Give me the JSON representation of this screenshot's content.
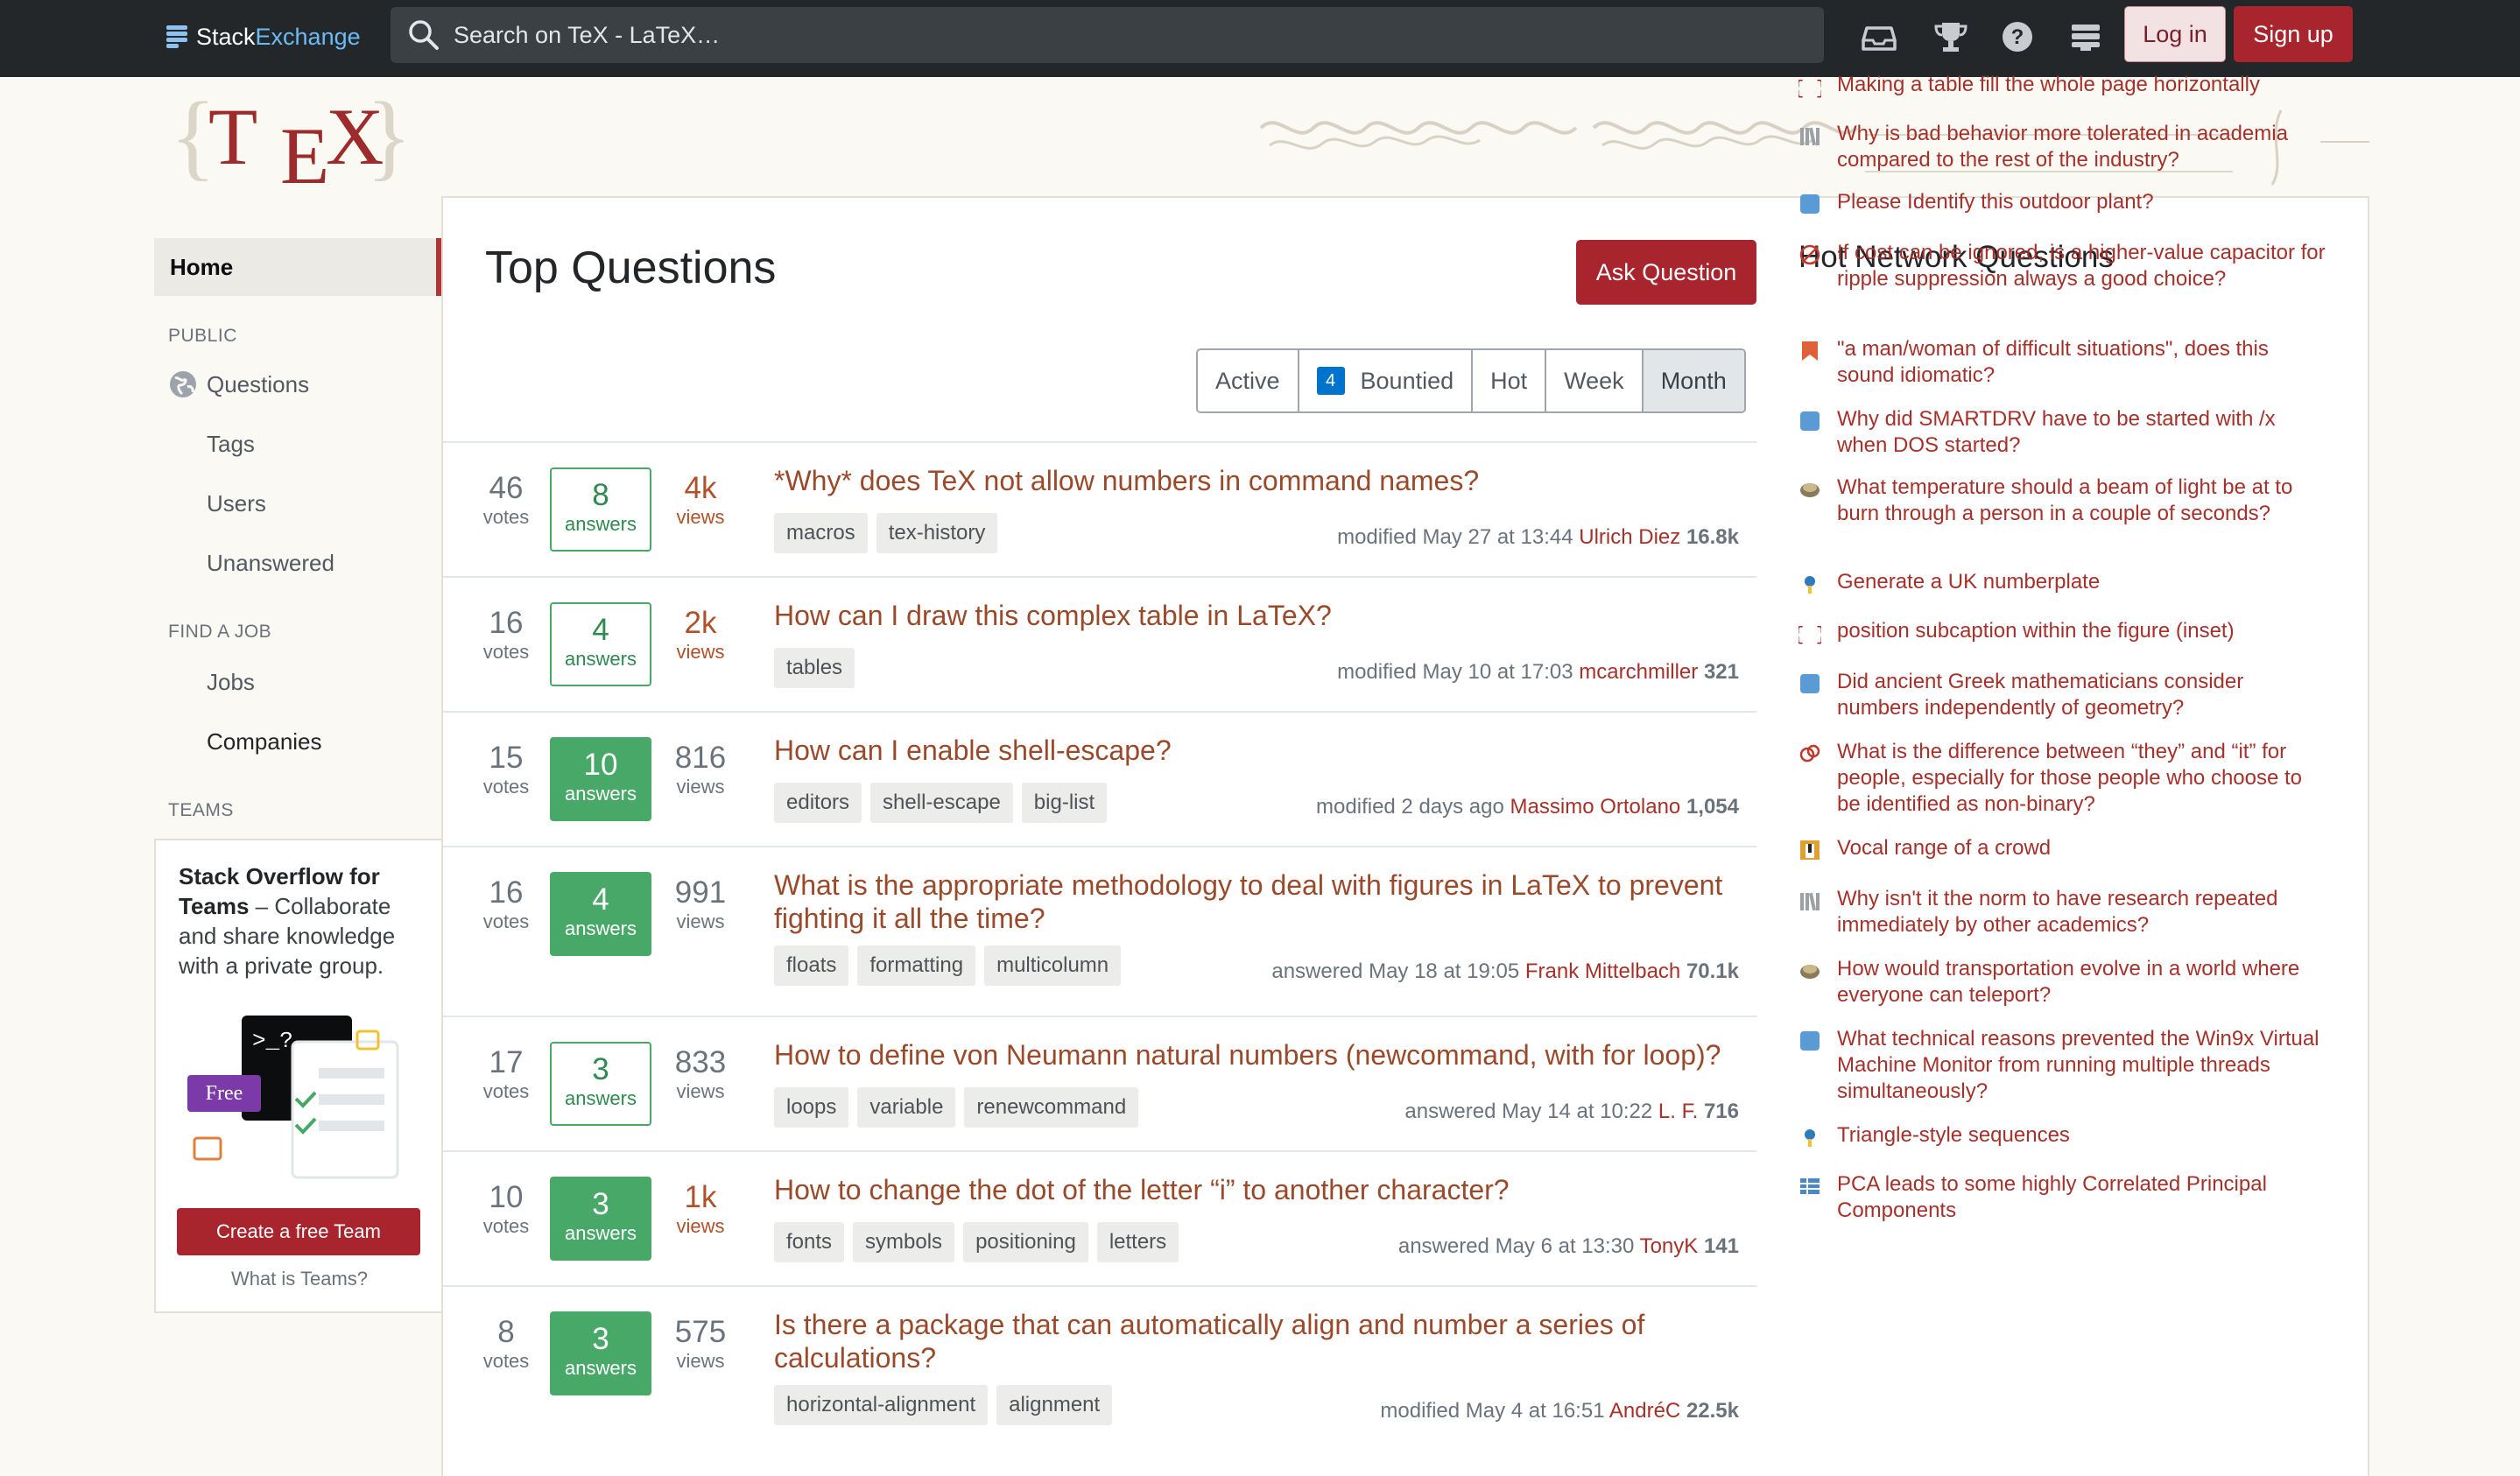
{
  "topbar": {
    "brand_a": "Stack",
    "brand_b": "Exchange",
    "search_placeholder": "Search on TeX - LaTeX…",
    "login": "Log in",
    "signup": "Sign up"
  },
  "nav": {
    "home": "Home",
    "public": "PUBLIC",
    "questions": "Questions",
    "tags": "Tags",
    "users": "Users",
    "unanswered": "Unanswered",
    "find_job": "FIND A JOB",
    "jobs": "Jobs",
    "companies": "Companies",
    "teams": "TEAMS",
    "teams_title": "Stack Overflow for Teams",
    "teams_desc": " – Collaborate and share knowledge with a private group.",
    "teams_free": "Free",
    "teams_terminal": ">_?",
    "create_team": "Create a free Team",
    "what_teams": "What is Teams?"
  },
  "main": {
    "title": "Top Questions",
    "ask": "Ask Question",
    "filters": [
      "Active",
      "Bountied",
      "Hot",
      "Week",
      "Month"
    ],
    "bounty_count": "4",
    "votes_label": "votes",
    "views_label": "views",
    "questions": [
      {
        "votes": "46",
        "answers": "8",
        "answers_label": "answers",
        "accepted": false,
        "views": "4k",
        "hot": true,
        "title": "*Why* does TeX not allow numbers in command names?",
        "tags": [
          "macros",
          "tex-history"
        ],
        "action": "modified May 27 at 13:44",
        "user": "Ulrich Diez",
        "rep": "16.8k"
      },
      {
        "votes": "16",
        "answers": "4",
        "answers_label": "answers",
        "accepted": false,
        "views": "2k",
        "hot": true,
        "title": "How can I draw this complex table in LaTeX?",
        "tags": [
          "tables"
        ],
        "action": "modified May 10 at 17:03",
        "user": "mcarchmiller",
        "rep": "321"
      },
      {
        "votes": "15",
        "answers": "10",
        "answers_label": "answers",
        "accepted": true,
        "views": "816",
        "hot": false,
        "title": "How can I enable shell-escape?",
        "tags": [
          "editors",
          "shell-escape",
          "big-list"
        ],
        "action": "modified 2 days ago",
        "user": "Massimo Ortolano",
        "rep": "1,054"
      },
      {
        "votes": "16",
        "answers": "4",
        "answers_label": "answers",
        "accepted": true,
        "views": "991",
        "hot": false,
        "title": "What is the appropriate methodology to deal with figures in LaTeX to prevent fighting it all the time?",
        "tags": [
          "floats",
          "formatting",
          "multicolumn"
        ],
        "action": "answered May 18 at 19:05",
        "user": "Frank Mittelbach",
        "rep": "70.1k"
      },
      {
        "votes": "17",
        "answers": "3",
        "answers_label": "answers",
        "accepted": false,
        "views": "833",
        "hot": false,
        "title": "How to define von Neumann natural numbers (newcommand, with for loop)?",
        "tags": [
          "loops",
          "variable",
          "renewcommand"
        ],
        "action": "answered May 14 at 10:22",
        "user": "L. F.",
        "rep": "716"
      },
      {
        "votes": "10",
        "answers": "3",
        "answers_label": "answers",
        "accepted": true,
        "views": "1k",
        "hot": true,
        "title": "How to change the dot of the letter “i” to another character?",
        "tags": [
          "fonts",
          "symbols",
          "positioning",
          "letters"
        ],
        "action": "answered May 6 at 13:30",
        "user": "TonyK",
        "rep": "141"
      },
      {
        "votes": "8",
        "answers": "3",
        "answers_label": "answers",
        "accepted": true,
        "views": "575",
        "hot": false,
        "title": "Is there a package that can automatically align and number a series of calculations?",
        "tags": [
          "horizontal-alignment",
          "alignment"
        ],
        "action": "modified May 4 at 16:51",
        "user": "AndréC",
        "rep": "22.5k"
      }
    ]
  },
  "sidebar": {
    "title": "Hot Network Questions",
    "items": [
      {
        "icon": "tex-icon",
        "color": "#a8252e",
        "text": "Making a table fill the whole page horizontally"
      },
      {
        "icon": "academia-icon",
        "color": "#9aa0a6",
        "text": "Why is bad behavior more tolerated in academia compared to the rest of the industry?"
      },
      {
        "icon": "biology-icon",
        "color": "#5b9bd5",
        "text": "Please Identify this outdoor plant?"
      },
      {
        "icon": "electronics-icon",
        "color": "#c0392b",
        "text": "If cost can be ignored, is a higher-value capacitor for ripple suppression always a good choice?"
      },
      {
        "icon": "english-icon",
        "color": "#e0603a",
        "text": "\"a man/woman of difficult situations\", does this sound idiomatic?"
      },
      {
        "icon": "retrocomputing-icon",
        "color": "#5b9bd5",
        "text": "Why did SMARTDRV have to be started with /x when DOS started?"
      },
      {
        "icon": "worldbuilding-icon",
        "color": "#8a7a5a",
        "text": "What temperature should a beam of light be at to burn through a person in a couple of seconds?"
      },
      {
        "icon": "codegolf-icon",
        "color": "#2d7bbd",
        "text": "Generate a UK numberplate"
      },
      {
        "icon": "tex-icon",
        "color": "#a8252e",
        "text": "position subcaption within the figure (inset)"
      },
      {
        "icon": "hsm-icon",
        "color": "#5b9bd5",
        "text": "Did ancient Greek mathematicians consider numbers independently of geometry?"
      },
      {
        "icon": "ell-icon",
        "color": "#c0392b",
        "text": "What is the difference between “they” and “it” for people, especially for those people who choose to be identified as non-binary?"
      },
      {
        "icon": "music-icon",
        "color": "#e0a030",
        "text": "Vocal range of a crowd"
      },
      {
        "icon": "academia-icon",
        "color": "#9aa0a6",
        "text": "Why isn't it the norm to have research repeated immediately by other academics?"
      },
      {
        "icon": "worldbuilding-icon",
        "color": "#8a7a5a",
        "text": "How would transportation evolve in a world where everyone can teleport?"
      },
      {
        "icon": "retrocomputing-icon",
        "color": "#5b9bd5",
        "text": "What technical reasons prevented the Win9x Virtual Machine Monitor from running multiple threads simultaneously?"
      },
      {
        "icon": "codegolf-icon",
        "color": "#2d7bbd",
        "text": "Triangle-style sequences"
      },
      {
        "icon": "stats-icon",
        "color": "#4a88c7",
        "text": "PCA leads to some highly Correlated Principal Components"
      }
    ]
  }
}
